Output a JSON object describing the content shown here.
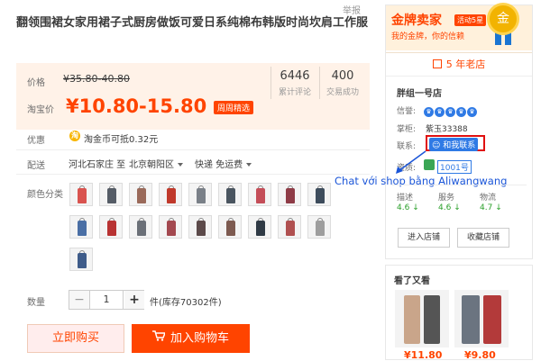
{
  "header": {
    "report": "举报"
  },
  "product": {
    "title": "翻领围裙女家用裙子式厨房做饭可爱日系纯棉布韩版时尚坎肩工作服",
    "price_label": "价格",
    "old_price": "¥35.80-40.80",
    "taobao_price_label": "淘宝价",
    "current_price": "¥10.80-15.80",
    "promo_badge": "周周精选",
    "reviews_count": "6446",
    "reviews_label": "累计评论",
    "deals_count": "400",
    "deals_label": "交易成功",
    "discount_label": "优惠",
    "coin_text": "淘金币可抵0.32元",
    "shipping_label": "配送",
    "shipping_from": "河北石家庄 至",
    "shipping_to": "北京朝阳区",
    "shipping_method": "快递 免运费",
    "color_label": "颜色分类",
    "quantity_label": "数量",
    "quantity_value": "1",
    "stock_text": "件(库存70302件)",
    "buy_now": "立即购买",
    "add_to_cart": "加入购物车"
  },
  "swatches": [
    {
      "color": "#d9534f"
    },
    {
      "color": "#555c66"
    },
    {
      "color": "#9a6a5a"
    },
    {
      "color": "#c0392b"
    },
    {
      "color": "#7a8088"
    },
    {
      "color": "#4a5560"
    },
    {
      "color": "#c44d58"
    },
    {
      "color": "#8e3b46"
    },
    {
      "color": "#3d4c5c"
    },
    {
      "color": "#4a6fa5"
    },
    {
      "color": "#b83232"
    },
    {
      "color": "#6b7078"
    },
    {
      "color": "#a3484f"
    },
    {
      "color": "#5c4a4a"
    },
    {
      "color": "#7d5a50"
    },
    {
      "color": "#2f3a45"
    },
    {
      "color": "#b05050"
    },
    {
      "color": "#9e9e9e"
    },
    {
      "color": "#3f5c8a"
    }
  ],
  "shop": {
    "gold_title": "金牌卖家",
    "gold_tag": "活动5星",
    "gold_sub": "我的金牌，你的信赖",
    "medal_char": "金",
    "years": "5 年老店",
    "name": "胖组一号店",
    "credit_label": "信誉:",
    "owner_label": "掌柜:",
    "owner_name": "紫玉33388",
    "contact_label": "联系:",
    "contact_button": "和我联系",
    "quals_label": "资质:",
    "quals_value": "1001号",
    "scores": [
      {
        "label": "描述",
        "value": "4.6"
      },
      {
        "label": "服务",
        "value": "4.6"
      },
      {
        "label": "物流",
        "value": "4.7"
      }
    ],
    "enter_shop": "进入店铺",
    "favorite_shop": "收藏店铺"
  },
  "annotation": {
    "text": "Chat với shop bằng Aliwangwang",
    "color": "#1a55d8"
  },
  "seen": {
    "title": "看了又看",
    "items": [
      {
        "price": "¥11.80"
      },
      {
        "price": "¥9.80"
      }
    ]
  },
  "colors": {
    "accent": "#ff4400",
    "price_bg": "#fff2e8",
    "highlight": "#e01010",
    "wangwang": "#2f7ae5"
  }
}
